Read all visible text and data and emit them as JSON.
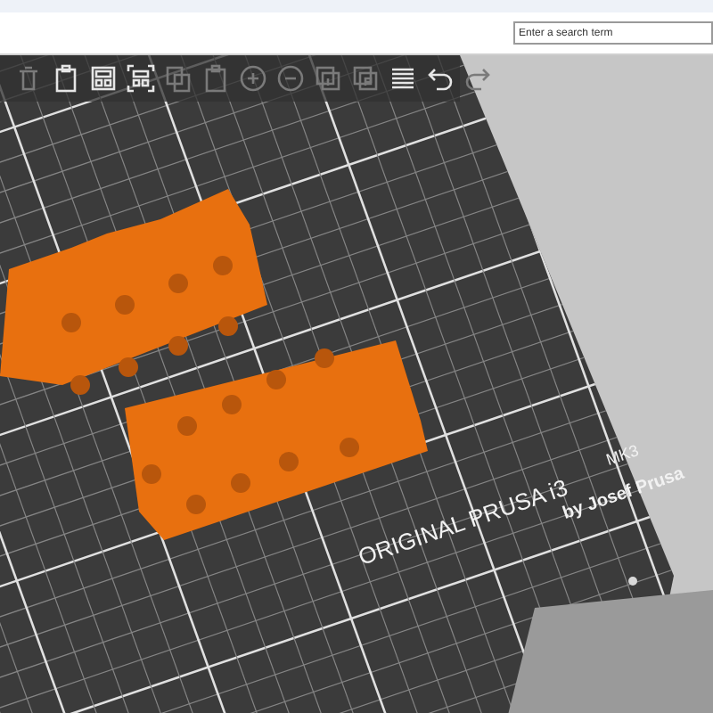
{
  "search": {
    "placeholder": "Enter a search term"
  },
  "toolbar": [
    {
      "kind": "delete",
      "disabled": true
    },
    {
      "kind": "paste",
      "disabled": false
    },
    {
      "kind": "arrange",
      "disabled": false
    },
    {
      "kind": "arrange-selection",
      "disabled": false
    },
    {
      "kind": "copy",
      "disabled": true
    },
    {
      "kind": "paste",
      "disabled": true
    },
    {
      "kind": "add",
      "disabled": true
    },
    {
      "kind": "remove",
      "disabled": true
    },
    {
      "kind": "split-objects",
      "disabled": true
    },
    {
      "kind": "split-parts",
      "disabled": true
    },
    {
      "kind": "layers",
      "disabled": false
    },
    {
      "kind": "undo",
      "disabled": false
    },
    {
      "kind": "redo",
      "disabled": true
    }
  ],
  "bed_label": {
    "title": "ORIGINAL PRUSA i3",
    "model": "MK3",
    "byline": "by Josef Prusa"
  }
}
